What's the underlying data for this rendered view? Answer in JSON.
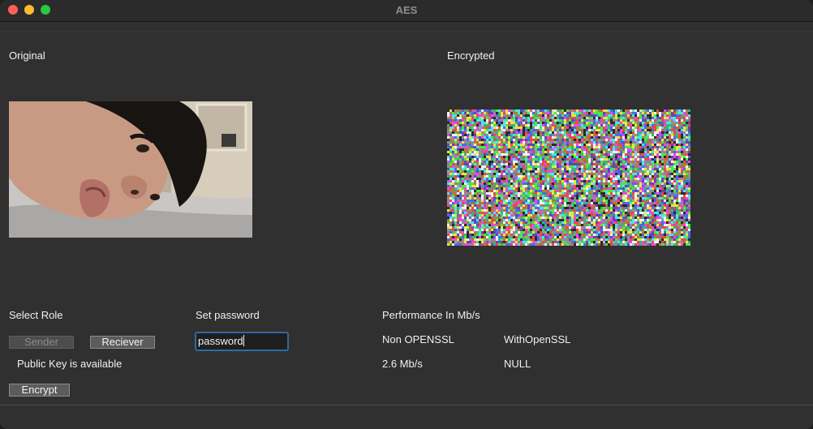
{
  "window": {
    "title": "AES"
  },
  "panels": {
    "original_label": "Original",
    "encrypted_label": "Encrypted"
  },
  "role": {
    "heading": "Select Role",
    "sender_label": "Sender",
    "receiver_label": "Reciever",
    "status_text": "Public Key is available",
    "encrypt_label": "Encrypt"
  },
  "password": {
    "heading": "Set password",
    "value": "password"
  },
  "performance": {
    "heading": "Performance In Mb/s",
    "col1_header": "Non OPENSSL",
    "col2_header": "WithOpenSSL",
    "col1_value": "2.6 Mb/s",
    "col2_value": "NULL"
  },
  "colors": {
    "focus_ring": "#2d6aa5",
    "close": "#ff5f57",
    "minimize": "#febc2e",
    "maximize": "#28c840"
  }
}
